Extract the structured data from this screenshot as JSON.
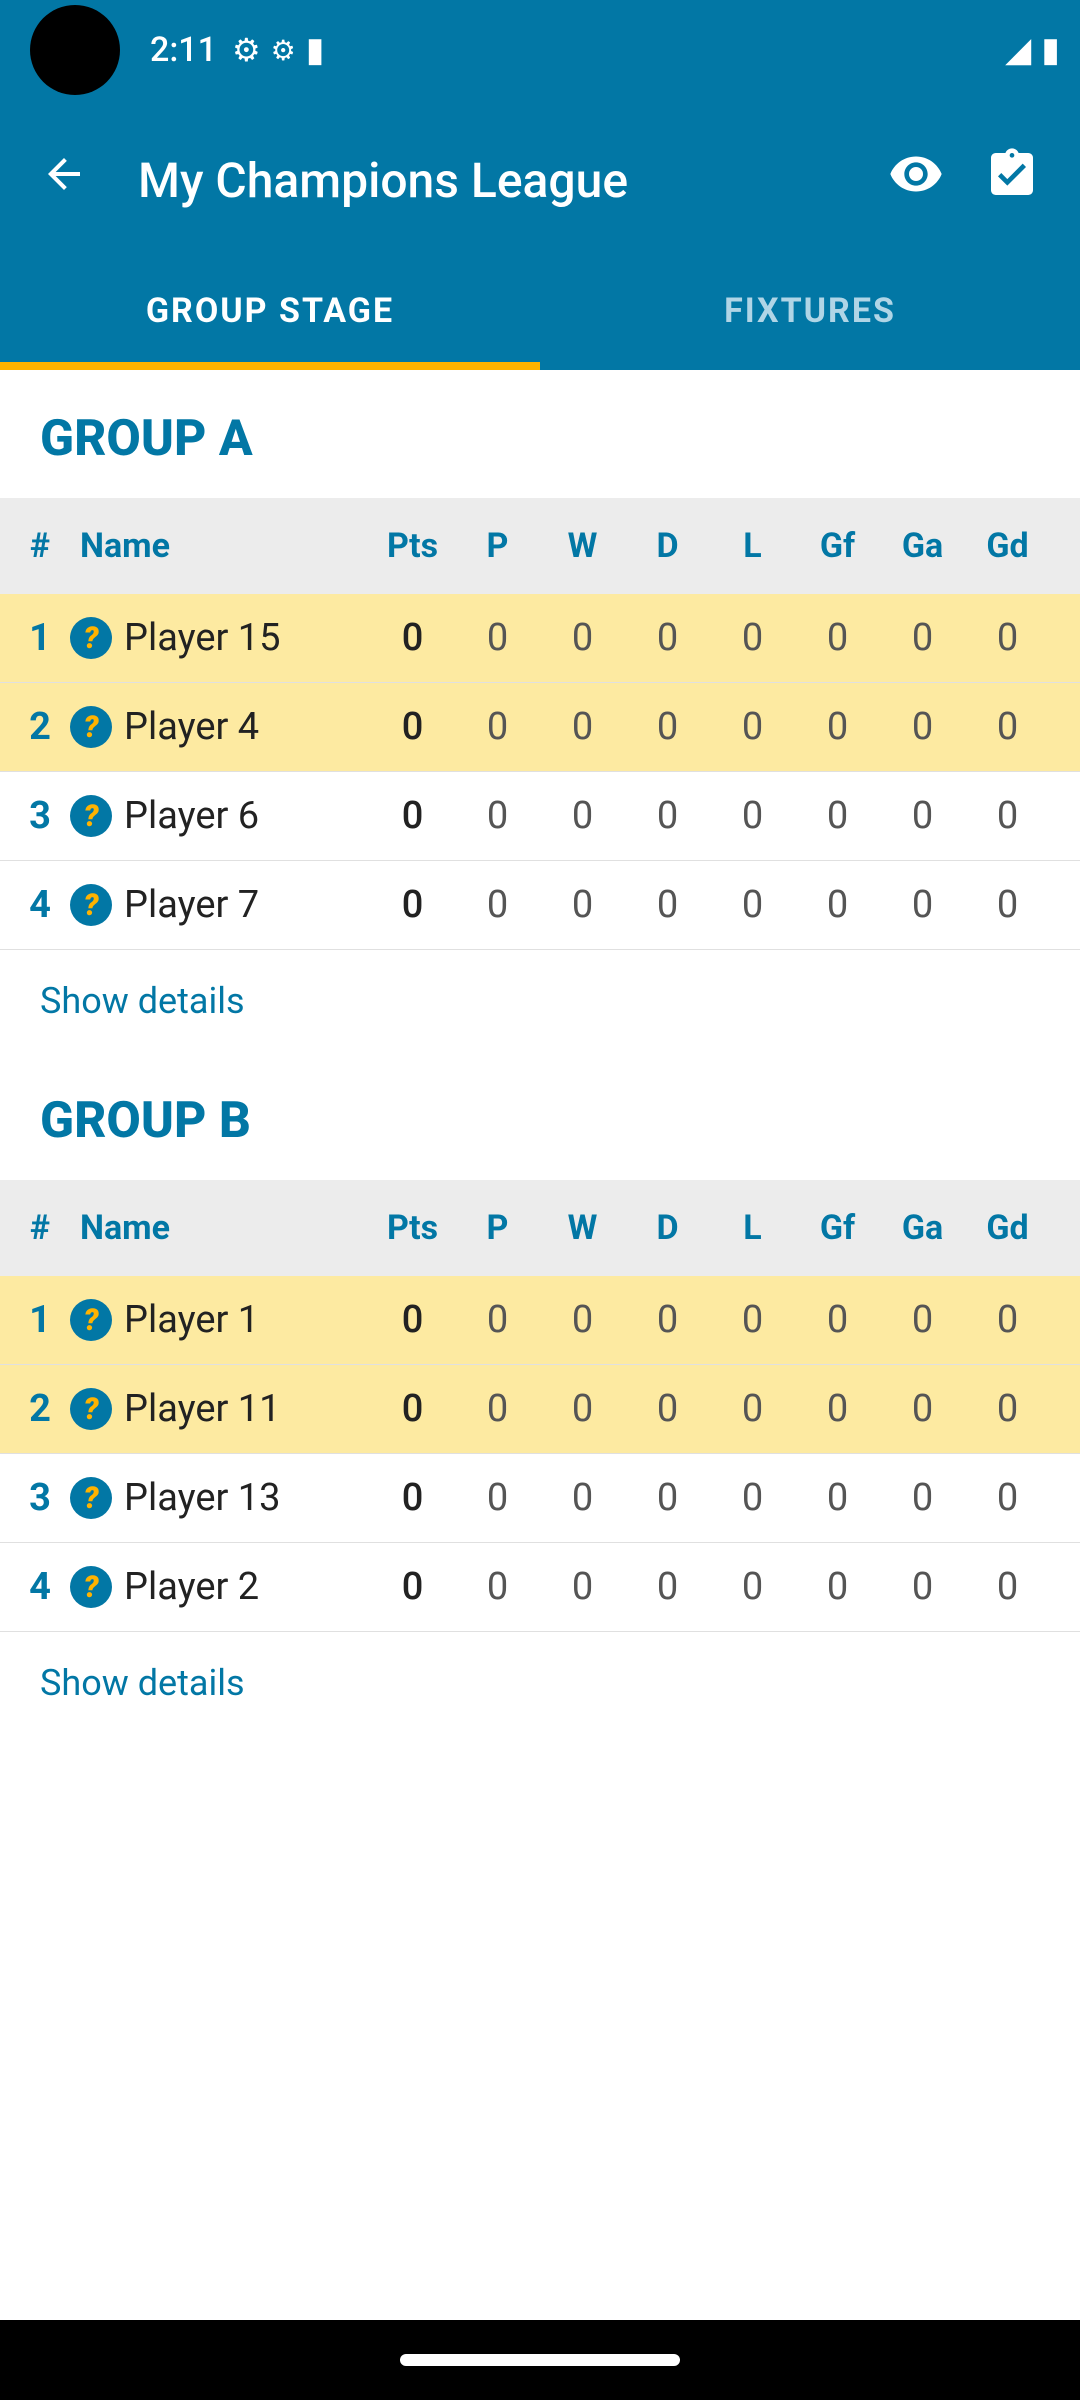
{
  "statusbar": {
    "time": "2:11"
  },
  "header": {
    "title": "My Champions League"
  },
  "tabs": {
    "group_stage": "GROUP STAGE",
    "fixtures": "FIXTURES"
  },
  "columns": {
    "rank": "#",
    "name": "Name",
    "pts": "Pts",
    "p": "P",
    "w": "W",
    "d": "D",
    "l": "L",
    "gf": "Gf",
    "ga": "Ga",
    "gd": "Gd"
  },
  "labels": {
    "show_details": "Show details"
  },
  "groups": [
    {
      "title": "GROUP A",
      "rows": [
        {
          "rank": "1",
          "name": "Player 15",
          "pts": "0",
          "p": "0",
          "w": "0",
          "d": "0",
          "l": "0",
          "gf": "0",
          "ga": "0",
          "gd": "0",
          "highlight": true
        },
        {
          "rank": "2",
          "name": "Player 4",
          "pts": "0",
          "p": "0",
          "w": "0",
          "d": "0",
          "l": "0",
          "gf": "0",
          "ga": "0",
          "gd": "0",
          "highlight": true
        },
        {
          "rank": "3",
          "name": "Player 6",
          "pts": "0",
          "p": "0",
          "w": "0",
          "d": "0",
          "l": "0",
          "gf": "0",
          "ga": "0",
          "gd": "0",
          "highlight": false
        },
        {
          "rank": "4",
          "name": "Player 7",
          "pts": "0",
          "p": "0",
          "w": "0",
          "d": "0",
          "l": "0",
          "gf": "0",
          "ga": "0",
          "gd": "0",
          "highlight": false
        }
      ]
    },
    {
      "title": "GROUP B",
      "rows": [
        {
          "rank": "1",
          "name": "Player 1",
          "pts": "0",
          "p": "0",
          "w": "0",
          "d": "0",
          "l": "0",
          "gf": "0",
          "ga": "0",
          "gd": "0",
          "highlight": true
        },
        {
          "rank": "2",
          "name": "Player 11",
          "pts": "0",
          "p": "0",
          "w": "0",
          "d": "0",
          "l": "0",
          "gf": "0",
          "ga": "0",
          "gd": "0",
          "highlight": true
        },
        {
          "rank": "3",
          "name": "Player 13",
          "pts": "0",
          "p": "0",
          "w": "0",
          "d": "0",
          "l": "0",
          "gf": "0",
          "ga": "0",
          "gd": "0",
          "highlight": false
        },
        {
          "rank": "4",
          "name": "Player 2",
          "pts": "0",
          "p": "0",
          "w": "0",
          "d": "0",
          "l": "0",
          "gf": "0",
          "ga": "0",
          "gd": "0",
          "highlight": false
        }
      ]
    }
  ]
}
